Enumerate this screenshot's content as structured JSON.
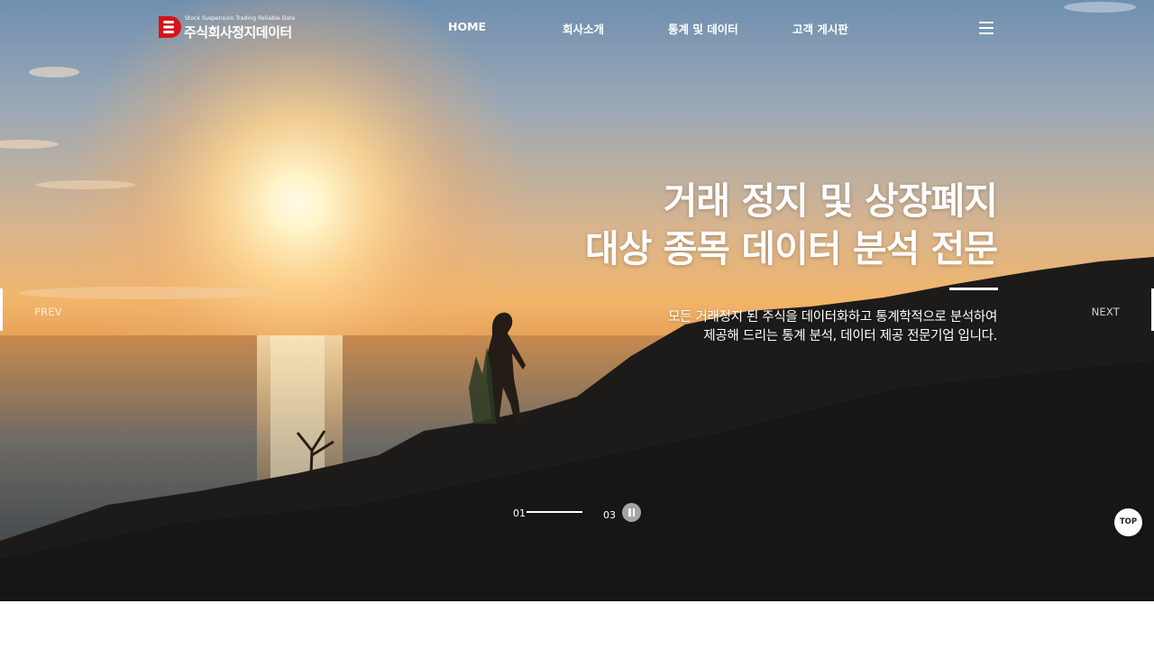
{
  "brand": {
    "tagline": "Stock Suspension Trading Reliable Data",
    "name": "주식회사정지데이터",
    "logo_color": "#d5141c"
  },
  "nav": {
    "items": [
      {
        "label": "HOME"
      },
      {
        "label": "회사소개"
      },
      {
        "label": "통계 및 데이터"
      },
      {
        "label": "고객 게시판"
      }
    ],
    "menu_icon": "hamburger-icon"
  },
  "hero": {
    "title_line1": "거래 정지 및 상장폐지",
    "title_line2": "대상 종목 데이터 분석 전문",
    "desc_line1": "모든 거래정지 된 주식을 데이터화하고 통계학적으로 분석하여",
    "desc_line2": "제공해 드리는 통계 분석, 데이터 제공 전문기업 입니다.",
    "prev_label": "PREV",
    "next_label": "NEXT"
  },
  "pager": {
    "current": "01",
    "total": "03",
    "pause_icon": "pause-icon"
  },
  "top_button": {
    "label": "TOP"
  }
}
